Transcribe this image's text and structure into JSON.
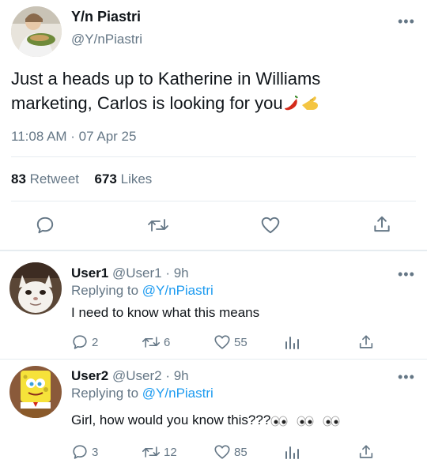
{
  "tweet": {
    "display_name": "Y/n Piastri",
    "handle": "@Y/nPiastri",
    "text": "Just a heads up to Katherine in Williams marketing, Carlos is looking for you",
    "emojis": [
      "hot-pepper",
      "pinched-fingers"
    ],
    "timestamp": "11:08 AM · 07 Apr 25",
    "retweet_count": "83",
    "retweet_label": "Retweet",
    "like_count": "673",
    "like_label": "Likes"
  },
  "replies": [
    {
      "display_name": "User1",
      "handle": "@User1",
      "time": "· 9h",
      "replying_label": "Replying to",
      "replying_to": "@Y/nPiastri",
      "text": "I need to know what this means",
      "emojis": [],
      "reply_count": "2",
      "retweet_count": "6",
      "like_count": "55"
    },
    {
      "display_name": "User2",
      "handle": "@User2",
      "time": "· 9h",
      "replying_label": "Replying to",
      "replying_to": "@Y/nPiastri",
      "text": "Girl, how would you know this???",
      "emojis": [
        "eyes",
        "eyes",
        "eyes"
      ],
      "reply_count": "3",
      "retweet_count": "12",
      "like_count": "85"
    }
  ],
  "colors": {
    "accent": "#1d9bf0",
    "muted": "#657786",
    "text": "#0f1419"
  }
}
